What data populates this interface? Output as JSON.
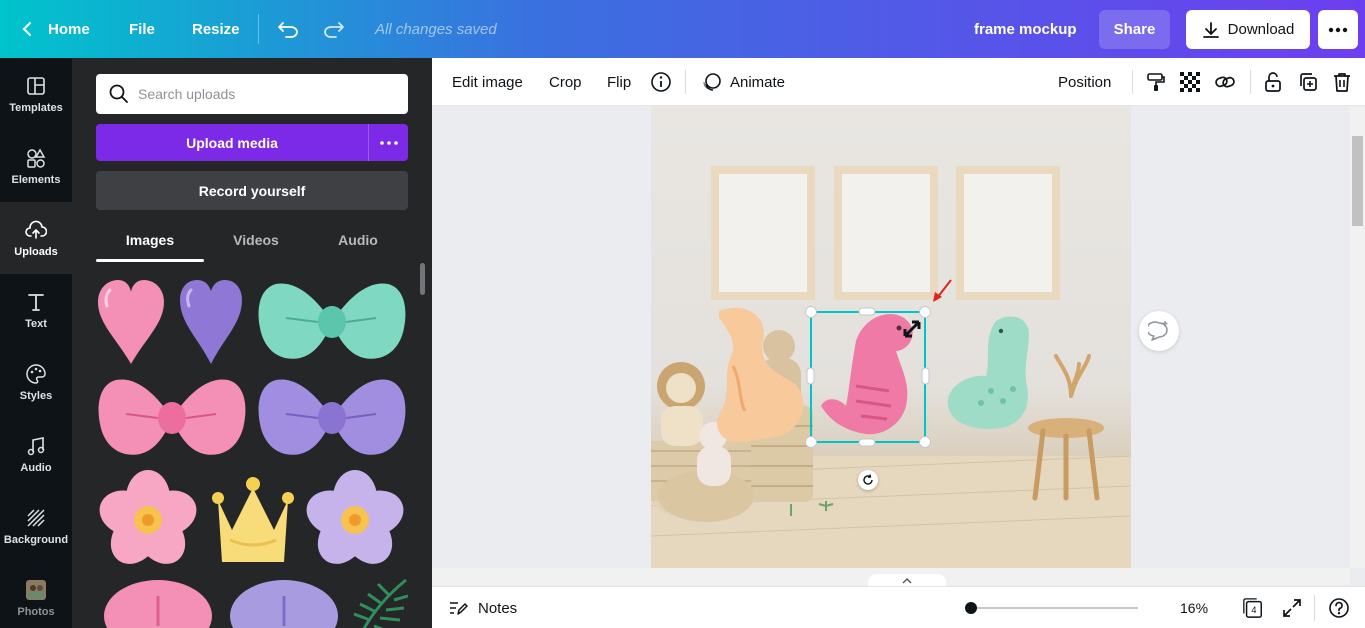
{
  "topbar": {
    "home": "Home",
    "file": "File",
    "resize": "Resize",
    "saved_status": "All changes saved",
    "design_title": "frame mockup",
    "share": "Share",
    "download": "Download"
  },
  "rail": {
    "items": [
      {
        "label": "Templates",
        "icon": "templates-icon"
      },
      {
        "label": "Elements",
        "icon": "elements-icon"
      },
      {
        "label": "Uploads",
        "icon": "upload-cloud-icon",
        "active": true
      },
      {
        "label": "Text",
        "icon": "text-icon"
      },
      {
        "label": "Styles",
        "icon": "palette-icon"
      },
      {
        "label": "Audio",
        "icon": "music-note-icon"
      },
      {
        "label": "Background",
        "icon": "background-icon"
      },
      {
        "label": "Photos",
        "icon": "photos-icon"
      }
    ]
  },
  "panel": {
    "search_placeholder": "Search uploads",
    "upload_media": "Upload media",
    "record_yourself": "Record yourself",
    "tabs": [
      "Images",
      "Videos",
      "Audio"
    ],
    "active_tab": "Images"
  },
  "context_toolbar": {
    "edit_image": "Edit image",
    "crop": "Crop",
    "flip": "Flip",
    "animate": "Animate",
    "position": "Position"
  },
  "bottom": {
    "notes": "Notes",
    "zoom": "16%",
    "page_count": "4",
    "zoom_level": 0.16
  },
  "colors": {
    "accent_purple": "#7d2ae8",
    "selection_cyan": "#00c4cc"
  }
}
